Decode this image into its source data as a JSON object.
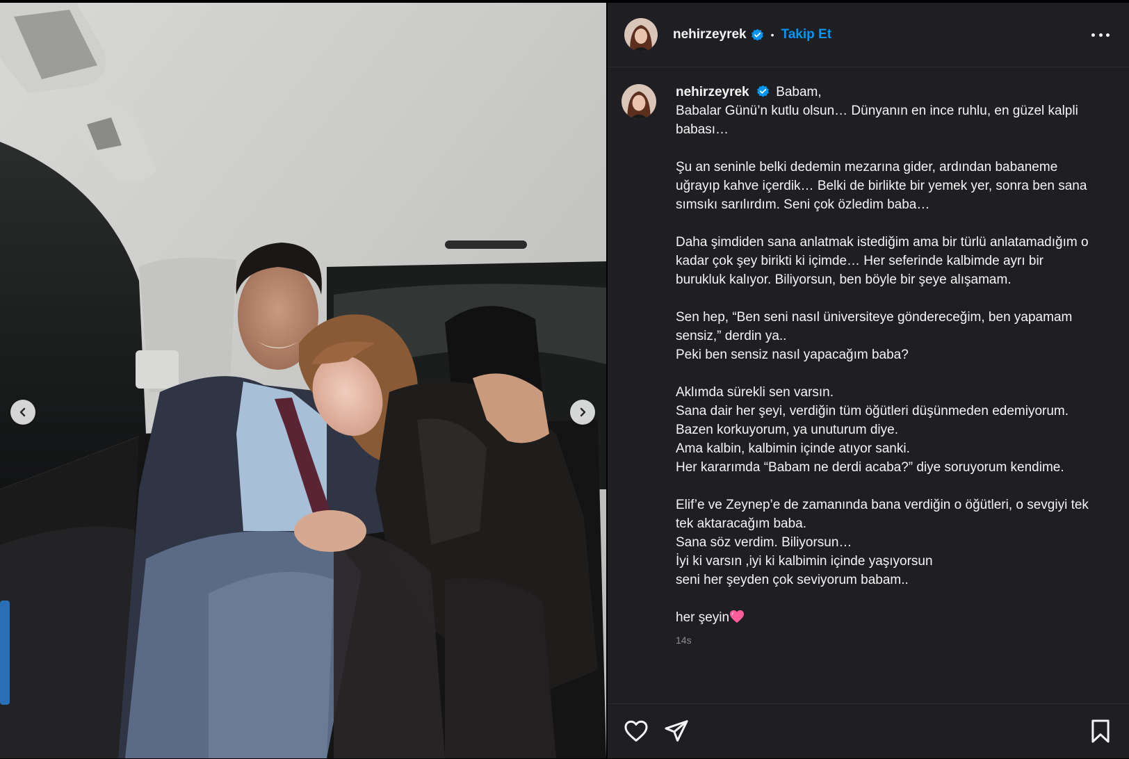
{
  "post": {
    "username": "nehirzeyrek",
    "follow_label": "Takip Et",
    "separator": "•",
    "caption_lines": [
      "Babam,",
      "Babalar Günü’n kutlu olsun… Dünyanın en ince ruhlu, en güzel kalpli babası…",
      "",
      "Şu an seninle belki dedemin mezarına gider, ardından babaneme uğrayıp kahve içerdik… Belki de birlikte bir yemek yer, sonra ben sana sımsıkı sarılırdım. Seni çok özledim baba…",
      "",
      "Daha şimdiden sana anlatmak istediğim ama bir türlü anlatamadığım o kadar çok şey birikti ki içimde… Her seferinde kalbimde ayrı bir burukluk kalıyor. Biliyorsun, ben böyle bir şeye alışamam.",
      "",
      "Sen hep, “Ben seni nasıl üniversiteye göndereceğim, ben yapamam sensiz,” derdin ya..",
      "Peki ben sensiz nasıl yapacağım baba?",
      "",
      "Aklımda sürekli sen varsın.",
      "Sana dair her şeyi, verdiğin tüm öğütleri düşünmeden edemiyorum.",
      "Bazen korkuyorum, ya unuturum diye.",
      "Ama kalbin, kalbimin içinde atıyor sanki.",
      "Her kararımda “Babam ne derdi acaba?” diye soruyorum kendime.",
      "",
      "Elif’e ve Zeynep’e de zamanında bana verdiğin o öğütleri, o sevgiyi tek tek aktaracağım baba.",
      "Sana söz verdim. Biliyorsun…",
      "İyi ki varsın ,iyi ki kalbimin içinde yaşıyorsun",
      "seni her şeyden çok seviyorum babam..",
      "",
      "her şeyin"
    ],
    "timestamp": "14s"
  },
  "icons": {
    "verified": "verified-badge-icon",
    "more": "more-options-icon",
    "like": "heart-icon",
    "share": "paper-plane-icon",
    "save": "bookmark-icon",
    "prev": "chevron-left-icon",
    "next": "chevron-right-icon",
    "emoji": "pink-heart-emoji"
  },
  "colors": {
    "panel_bg": "#1f1f23",
    "text": "#f5f5f5",
    "link": "#0095f6",
    "muted": "#8e8e8e",
    "verified": "#0095f6"
  }
}
